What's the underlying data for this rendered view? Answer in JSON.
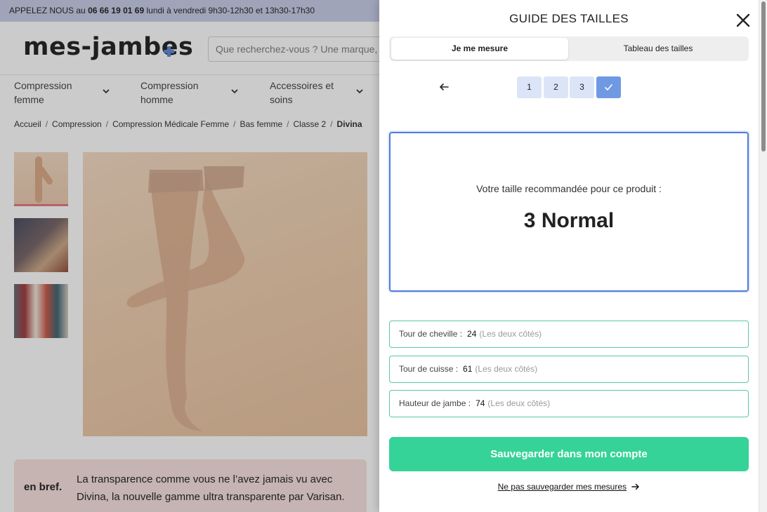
{
  "topbar": {
    "prefix": "APPELEZ NOUS au",
    "phone": "06 66 19 01 69",
    "hours": "lundi à vendredi 9h30-12h30 et 13h30-17h30"
  },
  "header": {
    "logo": "mes-jambes",
    "search_placeholder": "Que recherchez-vous ? Une marque, u"
  },
  "nav": {
    "items": [
      {
        "label": "Compression femme"
      },
      {
        "label": "Compression homme"
      },
      {
        "label": "Accessoires et soins"
      }
    ]
  },
  "breadcrumb": [
    "Accueil",
    "Compression",
    "Compression Médicale Femme",
    "Bas femme",
    "Classe 2",
    "Divina"
  ],
  "product": {
    "brief_title": "en bref.",
    "brief_text": "La transparence comme vous ne l’avez jamais vu avec Divina, la nouvelle gamme ultra transparente par Varisan."
  },
  "colors": {
    "accent_blue": "#4f7cd8",
    "step_blue": "#dbe5f7",
    "green": "#36d399"
  },
  "size_guide": {
    "title": "GUIDE DES TAILLES",
    "close_icon": "close-icon",
    "tabs": [
      {
        "label": "Je me mesure",
        "active": true
      },
      {
        "label": "Tableau des tailles",
        "active": false
      }
    ],
    "steps": [
      "1",
      "2",
      "3"
    ],
    "result_label": "Votre taille recommandée pour ce produit :",
    "result_size": "3 Normal",
    "measurements": [
      {
        "label": "Tour de cheville :",
        "value": "24",
        "note": "(Les deux côtés)"
      },
      {
        "label": "Tour de cuisse :",
        "value": "61",
        "note": "(Les deux côtés)"
      },
      {
        "label": "Hauteur de jambe :",
        "value": "74",
        "note": "(Les deux côtés)"
      }
    ],
    "save_label": "Sauvegarder dans mon compte",
    "skip_label": "Ne pas sauvegarder mes mesures"
  }
}
